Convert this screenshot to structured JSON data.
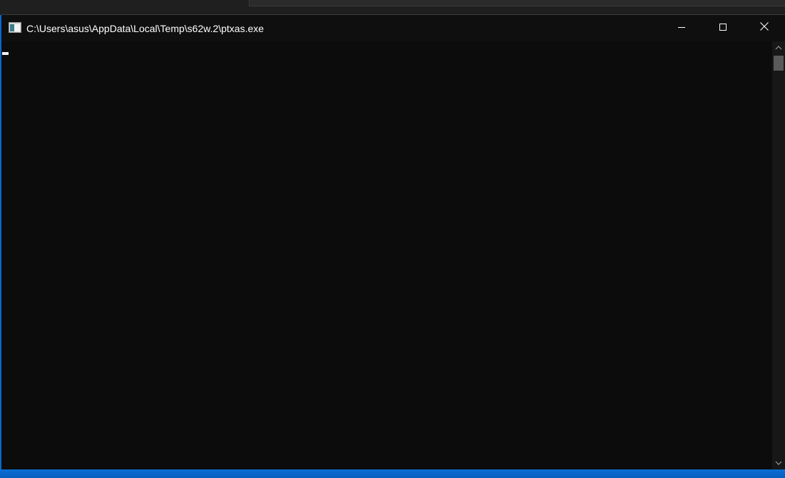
{
  "window": {
    "title": "C:\\Users\\asus\\AppData\\Local\\Temp\\s62w.2\\ptxas.exe",
    "icon": "console-app-icon"
  },
  "caption_buttons": {
    "minimize_icon": "minimize-icon",
    "maximize_icon": "maximize-icon",
    "close_icon": "close-icon"
  },
  "console": {
    "output": "",
    "cursor": "_",
    "background_color": "#0c0c0c",
    "text_color": "#f2f2f2"
  },
  "scrollbar": {
    "up_icon": "chevron-up-icon",
    "down_icon": "chevron-down-icon"
  }
}
